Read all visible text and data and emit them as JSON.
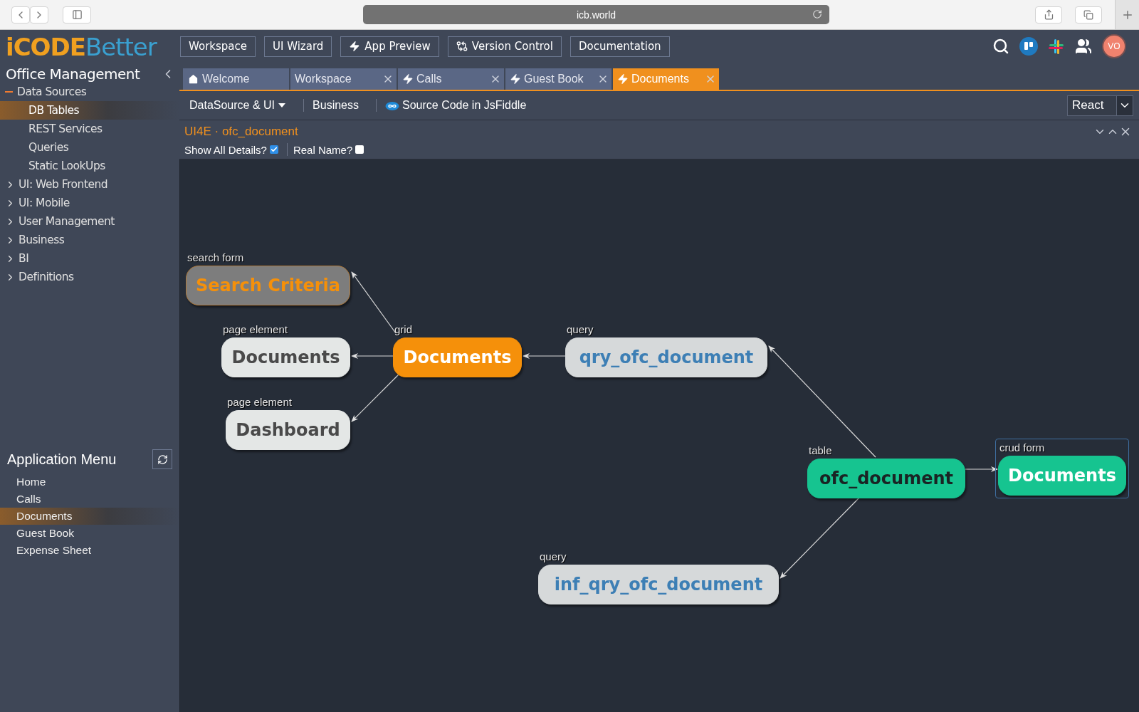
{
  "browser": {
    "url": "icb.world"
  },
  "logo": {
    "first": "iCODE",
    "second": "Better"
  },
  "nav": [
    {
      "label": "Workspace"
    },
    {
      "label": "UI Wizard"
    },
    {
      "label": "App Preview"
    },
    {
      "label": "Version Control"
    },
    {
      "label": "Documentation"
    }
  ],
  "user": {
    "initials": "VO"
  },
  "sidebar": {
    "title": "Office Management",
    "tree": [
      {
        "label": "Data Sources",
        "expanded": true,
        "children": [
          {
            "label": "DB Tables",
            "selected": true
          },
          {
            "label": "REST Services",
            "selected": false
          },
          {
            "label": "Queries",
            "selected": false
          },
          {
            "label": "Static LookUps",
            "selected": false
          }
        ]
      },
      {
        "label": "UI: Web Frontend",
        "expanded": false
      },
      {
        "label": "UI: Mobile",
        "expanded": false
      },
      {
        "label": "User Management",
        "expanded": false
      },
      {
        "label": "Business",
        "expanded": false
      },
      {
        "label": "BI",
        "expanded": false
      },
      {
        "label": "Definitions",
        "expanded": false
      }
    ],
    "app_menu": {
      "title": "Application Menu",
      "items": [
        {
          "label": "Home",
          "selected": false
        },
        {
          "label": "Calls",
          "selected": false
        },
        {
          "label": "Documents",
          "selected": true
        },
        {
          "label": "Guest Book",
          "selected": false
        },
        {
          "label": "Expense Sheet",
          "selected": false
        }
      ]
    }
  },
  "tabs": [
    {
      "label": "Welcome",
      "closable": false,
      "selected": false
    },
    {
      "label": "Workspace",
      "closable": true,
      "selected": false
    },
    {
      "label": "Calls",
      "closable": true,
      "selected": false
    },
    {
      "label": "Guest Book",
      "closable": true,
      "selected": false
    },
    {
      "label": "Documents",
      "closable": true,
      "selected": true
    }
  ],
  "toolbar": {
    "menu": "DataSource & UI",
    "business": "Business",
    "jsfiddle": "Source Code in JsFiddle",
    "framework": "React"
  },
  "panel": {
    "title": "UI4E · ofc_document",
    "options": [
      {
        "label": "Show All Details?",
        "checked": true
      },
      {
        "label": "Real Name?",
        "checked": false
      }
    ]
  },
  "diagram": {
    "nodes": [
      {
        "type": "search form",
        "name": "Search Criteria",
        "kind": "search",
        "selected": false
      },
      {
        "type": "page element",
        "name": "Documents",
        "kind": "page",
        "selected": false
      },
      {
        "type": "page element",
        "name": "Dashboard",
        "kind": "page",
        "selected": false
      },
      {
        "type": "grid",
        "name": "Documents",
        "kind": "grid",
        "selected": false
      },
      {
        "type": "query",
        "name": "qry_ofc_document",
        "kind": "query",
        "selected": false
      },
      {
        "type": "table",
        "name": "ofc_document",
        "kind": "table",
        "selected": false
      },
      {
        "type": "crud form",
        "name": "Documents",
        "kind": "crud",
        "selected": true
      },
      {
        "type": "query",
        "name": "inf_qry_ofc_document",
        "kind": "query",
        "selected": false
      }
    ]
  }
}
